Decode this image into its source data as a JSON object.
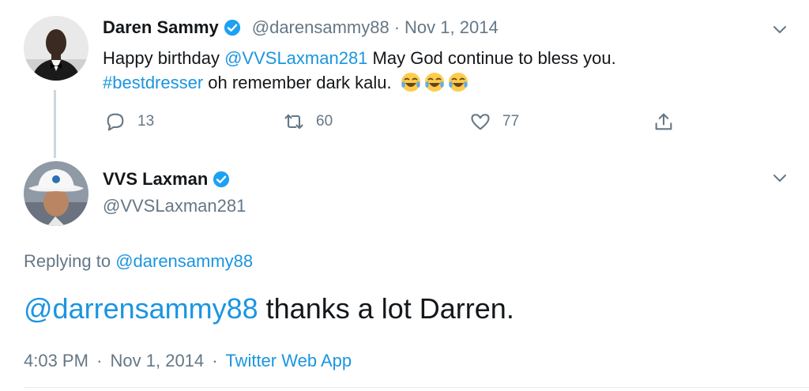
{
  "parent_tweet": {
    "name": "Daren Sammy",
    "handle": "@darensammy88",
    "separator": "·",
    "date": "Nov 1, 2014",
    "text_pre": "Happy birthday ",
    "mention": "@VVSLaxman281",
    "text_mid": " May God continue to bless you.",
    "hashtag": "#bestdresser",
    "text_post": " oh remember dark kalu.",
    "emoji": [
      "face-with-tears-of-joy",
      "face-with-tears-of-joy",
      "face-with-tears-of-joy"
    ],
    "reply_count": "13",
    "retweet_count": "60",
    "like_count": "77"
  },
  "main_tweet": {
    "name": "VVS Laxman",
    "handle": "@VVSLaxman281",
    "replying_label": "Replying to ",
    "replying_to": "@darensammy88",
    "mention": "@darrensammy88",
    "text": " thanks a lot Darren.",
    "time": "4:03 PM",
    "separator1": "·",
    "date": "Nov 1, 2014",
    "separator2": "·",
    "source": "Twitter Web App"
  },
  "colors": {
    "link": "#1b95e0",
    "muted": "#657786",
    "verified": "#1da1f2",
    "thread_line": "#ccd6dd"
  }
}
